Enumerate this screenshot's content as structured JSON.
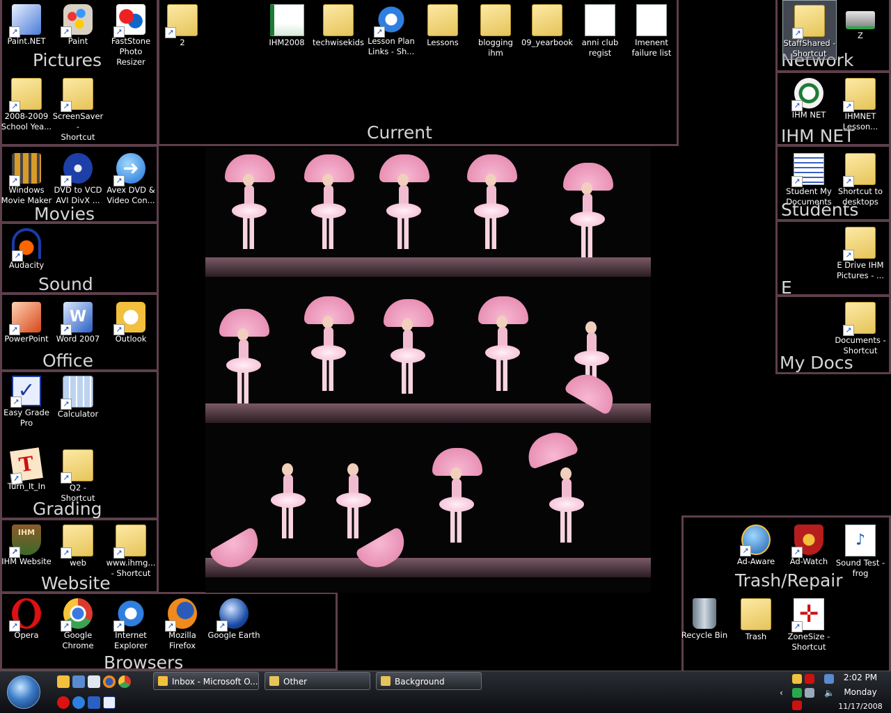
{
  "fences": {
    "pictures": "Pictures",
    "current": "Current",
    "movies": "Movies",
    "sound": "Sound",
    "office": "Office",
    "grading": "Grading",
    "website": "Website",
    "browsers": "Browsers",
    "network": "Network",
    "ihmnet": "IHM NET",
    "students": "Students",
    "e": "E",
    "mydocs": "My Docs",
    "trash": "Trash/Repair"
  },
  "icons": {
    "paintnet": [
      "Paint.NET"
    ],
    "paint": [
      "Paint"
    ],
    "faststone": [
      "FastStone",
      "Photo Resizer"
    ],
    "schoolyear": [
      "2008-2009",
      "School Yea..."
    ],
    "screensaver": [
      "ScreenSaver -",
      "Shortcut"
    ],
    "two": [
      "2"
    ],
    "ihm2008": [
      "IHM2008"
    ],
    "techwise": [
      "techwisekids"
    ],
    "lessonplan": [
      "Lesson Plan",
      "Links - Sh..."
    ],
    "lessons": [
      "Lessons"
    ],
    "blogging": [
      "blogging",
      "ihm"
    ],
    "yearbook": [
      "09_yearbook"
    ],
    "anniclub": [
      "anni club",
      "regist"
    ],
    "imenent": [
      "Imenent",
      "failure list"
    ],
    "moviemaker": [
      "Windows",
      "Movie Maker"
    ],
    "dvdvcd": [
      "DVD to VCD",
      "AVI DivX ..."
    ],
    "avex": [
      "Avex DVD &",
      "Video Con..."
    ],
    "audacity": [
      "Audacity"
    ],
    "powerpoint": [
      "PowerPoint"
    ],
    "word": [
      "Word 2007"
    ],
    "outlook": [
      "Outlook"
    ],
    "easygrade": [
      "Easy Grade",
      "Pro"
    ],
    "calculator": [
      "Calculator"
    ],
    "turnitin": [
      "Turn_It_In"
    ],
    "q2": [
      "Q2 - Shortcut"
    ],
    "ihmwebsite": [
      "IHM Website"
    ],
    "web": [
      "web"
    ],
    "wwwihm": [
      "www.ihmg...",
      "- Shortcut"
    ],
    "opera": [
      "Opera"
    ],
    "chrome": [
      "Google",
      "Chrome"
    ],
    "ie": [
      "Internet",
      "Explorer"
    ],
    "firefox": [
      "Mozilla",
      "Firefox"
    ],
    "gearth": [
      "Google Earth"
    ],
    "staffshared": [
      "StaffShared -",
      "Shortcut"
    ],
    "z": [
      "Z"
    ],
    "ihmnet": [
      "IHM NET"
    ],
    "ihmnetlesson": [
      "IHMNET",
      "Lesson..."
    ],
    "studentdocs": [
      "Student My",
      "Documents"
    ],
    "shortcutdesk": [
      "Shortcut to",
      "desktops"
    ],
    "edrive": [
      "E Drive IHM",
      "Pictures - ..."
    ],
    "documents": [
      "Documents -",
      "Shortcut"
    ],
    "adaware": [
      "Ad-Aware"
    ],
    "adwatch": [
      "Ad-Watch"
    ],
    "soundtest": [
      "Sound Test -",
      "frog"
    ],
    "recycle": [
      "Recycle Bin"
    ],
    "trashf": [
      "Trash"
    ],
    "zonesize": [
      "ZoneSize -",
      "Shortcut"
    ]
  },
  "taskbar": {
    "buttons": [
      "Inbox - Microsoft O...",
      "Other",
      "Background"
    ],
    "clock_time": "2:02 PM",
    "clock_day": "Monday",
    "clock_date": "11/17/2008"
  },
  "colors": {
    "fence_border": "#5e3f4c",
    "fence_title": "#d6d6d6",
    "desktop_bg": "#000000"
  }
}
